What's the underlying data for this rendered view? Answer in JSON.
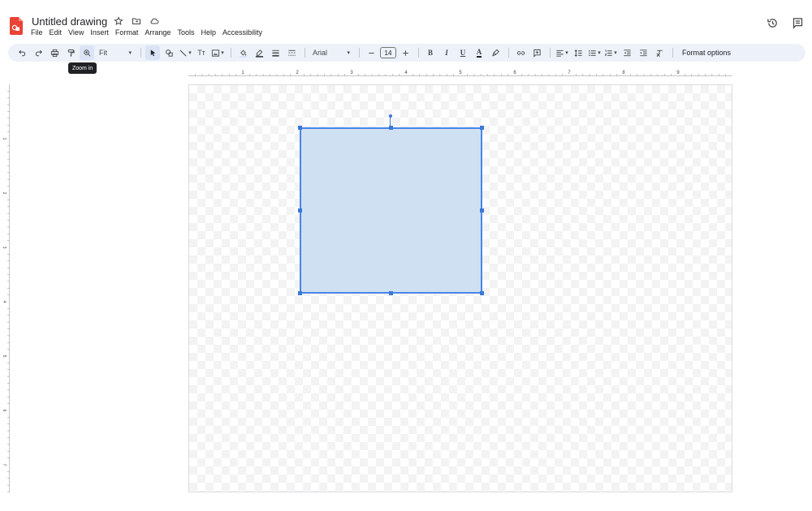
{
  "document": {
    "title": "Untitled drawing"
  },
  "menu": [
    "File",
    "Edit",
    "View",
    "Insert",
    "Format",
    "Arrange",
    "Tools",
    "Help",
    "Accessibility"
  ],
  "toolbar": {
    "zoom_value": "Fit",
    "font_name": "Arial",
    "font_size": "14",
    "bold": "B",
    "italic": "I",
    "underline": "U",
    "text_color": "A",
    "text_style": "Tт",
    "format_options": "Format options"
  },
  "tooltip": {
    "text": "Zoom in"
  },
  "ruler": {
    "h_labels": [
      "1",
      "2",
      "3",
      "4",
      "5",
      "6",
      "7",
      "8",
      "9"
    ],
    "v_labels": [
      "1",
      "2",
      "3",
      "4",
      "5",
      "6",
      "7"
    ]
  },
  "shape": {
    "fill": "#cfe0f3",
    "stroke": "#4a86e8"
  },
  "colors": {
    "accent": "#1a73e8",
    "toolbar_bg": "#edf2fa",
    "logo": "#ea4335"
  },
  "icons": [
    "drawings-logo-icon",
    "star-icon",
    "folder-icon",
    "cloud-icon",
    "history-icon",
    "comments-icon",
    "undo-icon",
    "redo-icon",
    "print-icon",
    "paint-format-icon",
    "zoom-in-icon",
    "select-icon",
    "shape-icon",
    "line-icon",
    "image-icon",
    "fill-color-icon",
    "pen-icon",
    "border-weight-icon",
    "border-dash-icon",
    "link-icon",
    "comment-add-icon",
    "align-icon",
    "line-spacing-icon",
    "bulleted-list-icon",
    "numbered-list-icon",
    "decrease-indent-icon",
    "increase-indent-icon",
    "clear-formatting-icon"
  ]
}
